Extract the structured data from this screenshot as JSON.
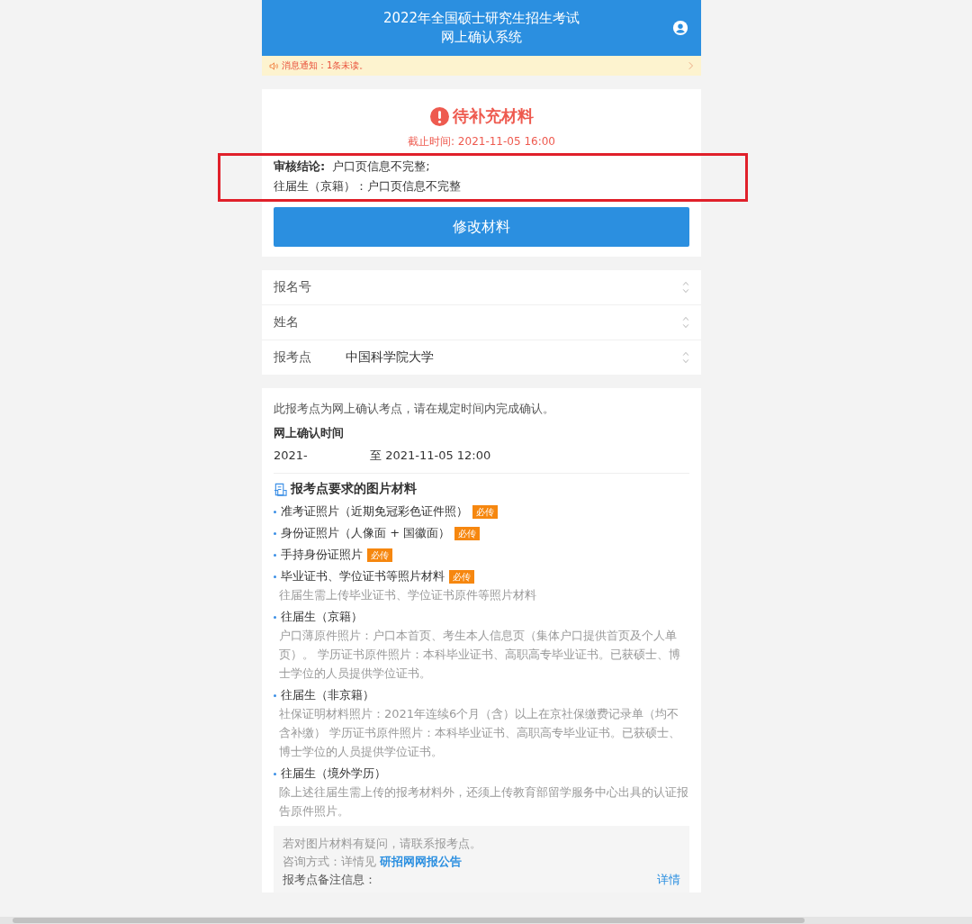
{
  "header": {
    "title_line1": "2022年全国硕士研究生招生考试",
    "title_line2": "网上确认系统"
  },
  "notice": {
    "text": "消息通知：1条未读。"
  },
  "status": {
    "title": "待补充材料",
    "deadline": "截止时间: 2021-11-05 16:00",
    "conclusion_label": "审核结论:",
    "conclusion_text": "户口页信息不完整;",
    "detail": "往届生（京籍）：户口页信息不完整",
    "highlighted": true,
    "button": "修改材料"
  },
  "form": [
    {
      "label": "报名号"
    },
    {
      "label": "姓名"
    },
    {
      "label": "报考点",
      "value": "中国科学院大学"
    }
  ],
  "info": {
    "intro": "此报考点为网上确认考点，请在规定时间内完成确认。",
    "time_title": "网上确认时间",
    "time_start": "2021-",
    "time_end": "至 2021-11-05 12:00"
  },
  "materials": {
    "title": "报考点要求的图片材料",
    "items": [
      {
        "title": "准考证照片（近期免冠彩色证件照）",
        "badge": "必传"
      },
      {
        "title": "身份证照片（人像面 + 国徽面）",
        "badge": "必传"
      },
      {
        "title": "手持身份证照片",
        "badge": "必传"
      },
      {
        "title": "毕业证书、学位证书等照片材料",
        "badge": "必传",
        "note": "往届生需上传毕业证书、学位证书原件等照片材料"
      },
      {
        "title": "往届生（京籍）",
        "note": "户口薄原件照片：户口本首页、考生本人信息页（集体户口提供首页及个人单页）。 学历证书原件照片：本科毕业证书、高职高专毕业证书。已获硕士、博士学位的人员提供学位证书。"
      },
      {
        "title": "往届生（非京籍）",
        "note": "社保证明材料照片：2021年连续6个月（含）以上在京社保缴费记录单（均不含补缴） 学历证书原件照片：本科毕业证书、高职高专毕业证书。已获硕士、博士学位的人员提供学位证书。"
      },
      {
        "title": "往届生（境外学历）",
        "note": "除上述往届生需上传的报考材料外，还须上传教育部留学服务中心出具的认证报告原件照片。"
      }
    ]
  },
  "contact": {
    "line1": "若对图片材料有疑问，请联系报考点。",
    "line2_prefix": "咨询方式：详情见 ",
    "line2_link": "研招网网报公告",
    "remark_label": "报考点备注信息：",
    "more_link": "详情"
  }
}
